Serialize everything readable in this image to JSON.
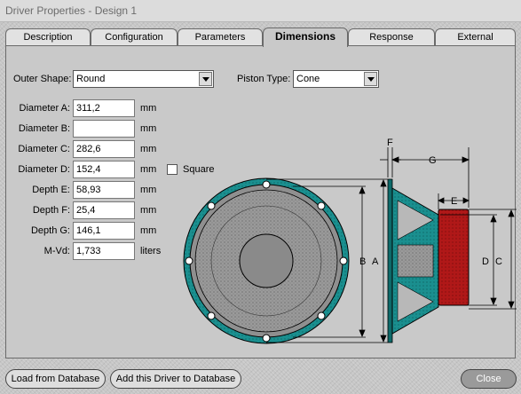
{
  "window": {
    "title": "Driver Properties - Design 1"
  },
  "tabs": [
    {
      "label": "Description"
    },
    {
      "label": "Configuration"
    },
    {
      "label": "Parameters"
    },
    {
      "label": "Dimensions"
    },
    {
      "label": "Response"
    },
    {
      "label": "External"
    }
  ],
  "active_tab": "Dimensions",
  "outer_shape": {
    "label": "Outer Shape:",
    "value": "Round"
  },
  "piston_type": {
    "label": "Piston Type:",
    "value": "Cone"
  },
  "fields": [
    {
      "label": "Diameter A:",
      "value": "311,2",
      "unit": "mm"
    },
    {
      "label": "Diameter B:",
      "value": "",
      "unit": "mm"
    },
    {
      "label": "Diameter C:",
      "value": "282,6",
      "unit": "mm"
    },
    {
      "label": "Diameter D:",
      "value": "152,4",
      "unit": "mm"
    },
    {
      "label": "Depth E:",
      "value": "58,93",
      "unit": "mm"
    },
    {
      "label": "Depth F:",
      "value": "25,4",
      "unit": "mm"
    },
    {
      "label": "Depth G:",
      "value": "146,1",
      "unit": "mm"
    },
    {
      "label": "M-Vd:",
      "value": "1,733",
      "unit": "liters"
    }
  ],
  "square": {
    "label": "Square",
    "checked": false
  },
  "diagram_labels": {
    "A": "A",
    "B": "B",
    "C": "C",
    "D": "D",
    "E": "E",
    "F": "F",
    "G": "G"
  },
  "buttons": {
    "load": "Load from Database",
    "add": "Add this Driver to Database",
    "close": "Close"
  },
  "colors": {
    "basket": "#1a8f8f",
    "magnet": "#b01818",
    "cone": "#8a8a8a"
  }
}
